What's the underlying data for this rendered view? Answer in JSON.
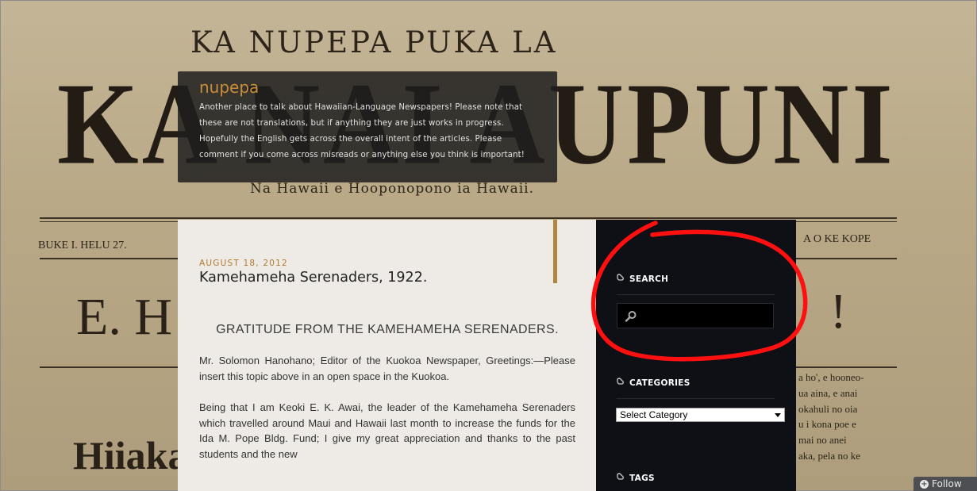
{
  "background": {
    "masthead_top": "KA NUPEPA PUKA LA",
    "masthead_main": "KA NAI AUPUNI",
    "motto": "Na Hawaii e Hooponopono ia Hawaii.",
    "buke": "BUKE I.  HELU 27.",
    "kope": "A O KE KOPE",
    "headline_left": "E. H",
    "headline_right": "!",
    "subhead": "Hiiaka-",
    "column_lines": [
      "a ho', e hooneo-",
      "ua aina, e anai",
      "okahuli  no oia",
      "u  i kona poe e",
      "mai  no anei",
      "aka, pela no ke"
    ]
  },
  "header": {
    "site_title": "nupepa",
    "description": "Another place to talk about Hawaiian-Language Newspapers! Please note that these are not translations, but if anything they are just works in progress. Hopefully the English gets across the overall intent of the articles. Please comment if you come across misreads or anything else you think is important!"
  },
  "post": {
    "date": "AUGUST 18, 2012",
    "title": "Kamehameha Serenaders, 1922.",
    "heading": "GRATITUDE FROM THE KAMEHAMEHA SERENADERS.",
    "paragraphs": [
      "Mr. Solomon Hanohano; Editor of the Kuokoa Newspaper, Greetings:—Please insert this topic above in an open space in the Kuokoa.",
      "Being that I am Keoki E. K. Awai, the leader of the Kamehameha Serenaders which travelled around Maui and Hawaii last month to increase the funds for the Ida M. Pope Bldg. Fund; I give my great appreciation and thanks to the past students and the new"
    ]
  },
  "sidebar": {
    "search_title": "SEARCH",
    "search_value": "",
    "categories_title": "CATEGORIES",
    "categories_selected": "Select Category",
    "tags_title": "TAGS"
  },
  "icons": {
    "widget_title_icon": "shoe-tread-icon",
    "search_icon": "magnifier-icon",
    "follow_icon": "plus-circle-icon"
  },
  "colors": {
    "accent": "#b0853e",
    "title_orange": "#c98e3a",
    "sidebar_bg": "#0e1016",
    "annotation_red": "#ff0000"
  },
  "follow": {
    "label": "Follow"
  }
}
